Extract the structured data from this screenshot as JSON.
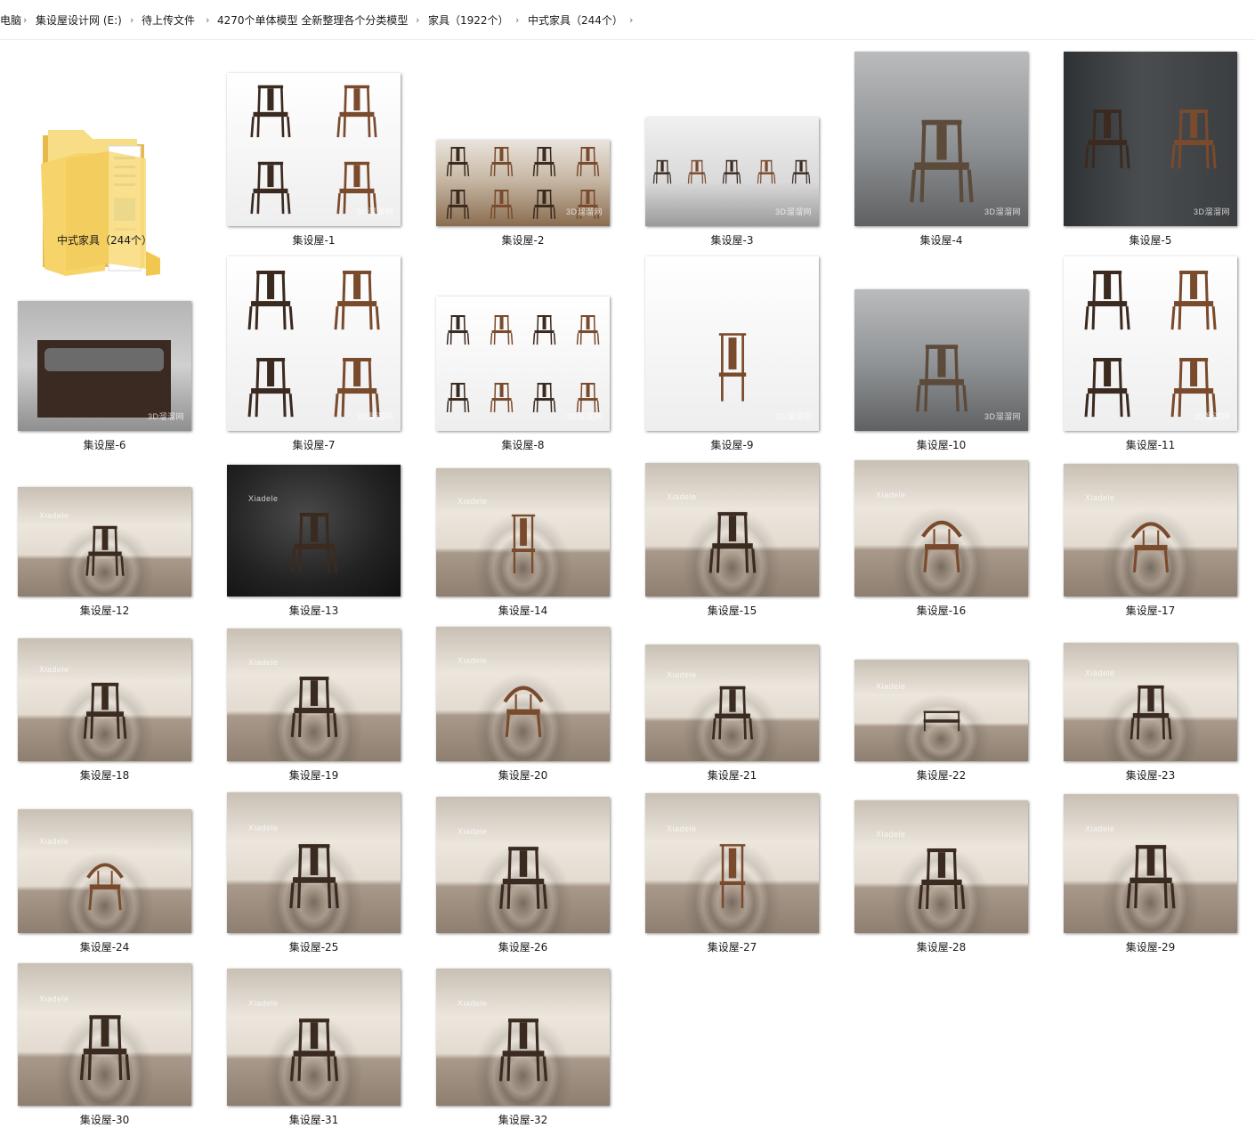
{
  "breadcrumb": {
    "segments": [
      "电脑",
      "集设屋设计网 (E:)",
      "待上传文件",
      "4270个单体模型 全新整理各个分类模型",
      "家具（1922个）",
      "中式家具（244个）"
    ],
    "separator": "›"
  },
  "folder": {
    "label": "中式家具（244个）",
    "icon": "folder-icon"
  },
  "files": [
    "集设屋-1",
    "集设屋-2",
    "集设屋-3",
    "集设屋-4",
    "集设屋-5",
    "集设屋-6",
    "集设屋-7",
    "集设屋-8",
    "集设屋-9",
    "集设屋-10",
    "集设屋-11",
    "集设屋-12",
    "集设屋-13",
    "集设屋-14",
    "集设屋-15",
    "集设屋-16",
    "集设屋-17",
    "集设屋-18",
    "集设屋-19",
    "集设屋-20",
    "集设屋-21",
    "集设屋-22",
    "集设屋-23",
    "集设屋-24",
    "集设屋-25",
    "集设屋-26",
    "集设屋-27",
    "集设屋-28",
    "集设屋-29",
    "集设屋-30",
    "集设屋-31",
    "集设屋-32"
  ],
  "watermarks": {
    "site": "3D溜溜网",
    "brand": "Xiadele"
  },
  "colors": {
    "chair_dark": "#3b2a20",
    "chair_wood": "#7a4a2c",
    "folder": "#f5d774"
  }
}
